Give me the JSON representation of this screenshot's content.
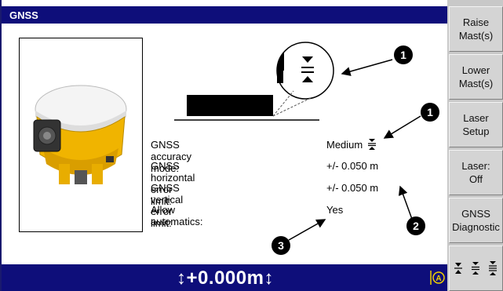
{
  "title": "GNSS",
  "rows": [
    {
      "label": "GNSS accuracy mode:",
      "value": "Medium"
    },
    {
      "label": "GNSS horizontal error limit:",
      "value": "+/- 0.050 m"
    },
    {
      "label": "GNSS vertical error limit:",
      "value": "+/- 0.050 m"
    },
    {
      "label": "Allow automatics:",
      "value": "Yes"
    }
  ],
  "callouts": [
    "1",
    "1",
    "2",
    "3"
  ],
  "status": {
    "elevation": "↕+0.000m↕"
  },
  "softkeys": [
    {
      "line1": "Raise",
      "line2": "Mast(s)"
    },
    {
      "line1": "Lower",
      "line2": "Mast(s)"
    },
    {
      "line1": "Laser",
      "line2": "Setup"
    },
    {
      "line1": "Laser:",
      "line2": "Off"
    },
    {
      "line1": "GNSS",
      "line2": "Diagnostic"
    }
  ],
  "icons": {
    "accuracy_mode": "medium-accuracy-icon",
    "softkey_6": [
      "high-accuracy-icon",
      "medium-accuracy-icon",
      "low-accuracy-icon"
    ],
    "status": "automatics-icon"
  },
  "colors": {
    "title_bar": "#0e0e7a",
    "softkey_bg": "#d4d4d4",
    "receiver_yellow": "#f0b400"
  }
}
